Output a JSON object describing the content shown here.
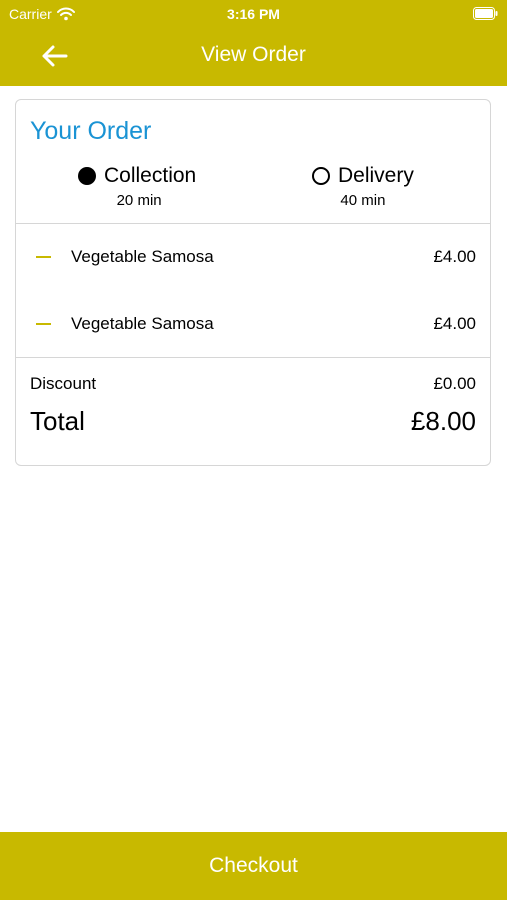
{
  "status_bar": {
    "carrier": "Carrier",
    "time": "3:16 PM",
    "wifi_icon": "wifi-icon",
    "battery_icon": "battery-icon"
  },
  "nav": {
    "back_icon": "arrow-left-icon",
    "title": "View Order"
  },
  "order": {
    "title": "Your Order",
    "options": [
      {
        "label": "Collection",
        "time": "20 min",
        "selected": true
      },
      {
        "label": "Delivery",
        "time": "40 min",
        "selected": false
      }
    ],
    "items": [
      {
        "name": "Vegetable Samosa",
        "price": "£4.00",
        "remove_icon": "minus-icon"
      },
      {
        "name": "Vegetable Samosa",
        "price": "£4.00",
        "remove_icon": "minus-icon"
      }
    ],
    "discount_label": "Discount",
    "discount_value": "£0.00",
    "total_label": "Total",
    "total_value": "£8.00"
  },
  "checkout_label": "Checkout",
  "colors": {
    "brand": "#c8b900",
    "title_blue": "#1a93d4",
    "border": "#d6d6d6"
  }
}
